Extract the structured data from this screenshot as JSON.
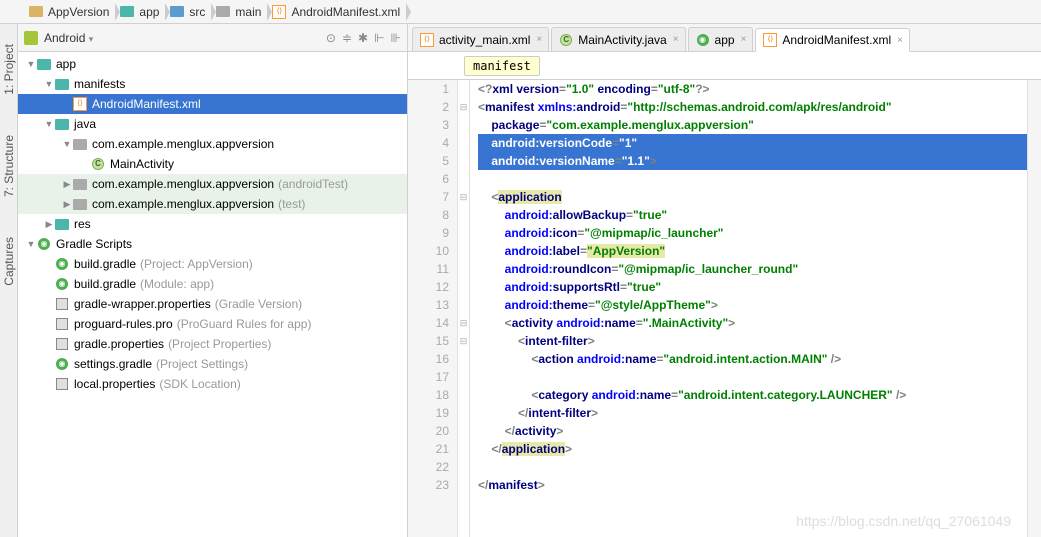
{
  "breadcrumb": [
    {
      "icon": "folder",
      "label": "AppVersion"
    },
    {
      "icon": "folder-teal",
      "label": "app"
    },
    {
      "icon": "folder-blue",
      "label": "src"
    },
    {
      "icon": "folder-gray",
      "label": "main"
    },
    {
      "icon": "xml",
      "label": "AndroidManifest.xml"
    }
  ],
  "leftTabs": [
    "1: Project",
    "7: Structure",
    "Captures"
  ],
  "sidebar": {
    "dropdown": "Android",
    "toolbarIcons": [
      "target",
      "collapse",
      "expand",
      "settings",
      "hide"
    ]
  },
  "tree": [
    {
      "depth": 0,
      "arrow": "▼",
      "icon": "folder-teal",
      "label": "app"
    },
    {
      "depth": 1,
      "arrow": "▼",
      "icon": "folder-teal",
      "label": "manifests"
    },
    {
      "depth": 2,
      "arrow": "",
      "icon": "xml",
      "label": "AndroidManifest.xml",
      "selected": true
    },
    {
      "depth": 1,
      "arrow": "▼",
      "icon": "folder-teal",
      "label": "java"
    },
    {
      "depth": 2,
      "arrow": "▼",
      "icon": "folder-gray",
      "label": "com.example.menglux.appversion"
    },
    {
      "depth": 3,
      "arrow": "",
      "icon": "class",
      "label": "MainActivity"
    },
    {
      "depth": 2,
      "arrow": "▶",
      "icon": "folder-gray",
      "label": "com.example.menglux.appversion",
      "hint": "(androidTest)",
      "hl": true
    },
    {
      "depth": 2,
      "arrow": "▶",
      "icon": "folder-gray",
      "label": "com.example.menglux.appversion",
      "hint": "(test)",
      "hl": true
    },
    {
      "depth": 1,
      "arrow": "▶",
      "icon": "folder-teal",
      "label": "res"
    },
    {
      "depth": 0,
      "arrow": "▼",
      "icon": "gradle",
      "label": "Gradle Scripts"
    },
    {
      "depth": 1,
      "arrow": "",
      "icon": "gradle",
      "label": "build.gradle",
      "hint": "(Project: AppVersion)"
    },
    {
      "depth": 1,
      "arrow": "",
      "icon": "gradle",
      "label": "build.gradle",
      "hint": "(Module: app)"
    },
    {
      "depth": 1,
      "arrow": "",
      "icon": "prop",
      "label": "gradle-wrapper.properties",
      "hint": "(Gradle Version)"
    },
    {
      "depth": 1,
      "arrow": "",
      "icon": "prop",
      "label": "proguard-rules.pro",
      "hint": "(ProGuard Rules for app)"
    },
    {
      "depth": 1,
      "arrow": "",
      "icon": "prop",
      "label": "gradle.properties",
      "hint": "(Project Properties)"
    },
    {
      "depth": 1,
      "arrow": "",
      "icon": "gradle",
      "label": "settings.gradle",
      "hint": "(Project Settings)"
    },
    {
      "depth": 1,
      "arrow": "",
      "icon": "prop",
      "label": "local.properties",
      "hint": "(SDK Location)"
    }
  ],
  "tabs": [
    {
      "icon": "xml",
      "label": "activity_main.xml",
      "active": false
    },
    {
      "icon": "class",
      "label": "MainActivity.java",
      "active": false
    },
    {
      "icon": "gradle",
      "label": "app",
      "active": false
    },
    {
      "icon": "xml",
      "label": "AndroidManifest.xml",
      "active": true
    }
  ],
  "crumb": "manifest",
  "code": {
    "lines": [
      {
        "n": 1,
        "fold": "",
        "html": "<span class='c'>&lt;?</span><span class='k'>xml version</span><span class='c'>=</span><span class='s'>\"1.0\"</span> <span class='k'>encoding</span><span class='c'>=</span><span class='s'>\"utf-8\"</span><span class='c'>?&gt;</span>"
      },
      {
        "n": 2,
        "fold": "⊟",
        "html": "<span class='c'>&lt;</span><span class='k'>manifest </span><span class='a'>xmlns:</span><span class='k'>android</span><span class='c'>=</span><span class='s'>\"http://schemas.android.com/apk/res/android\"</span>"
      },
      {
        "n": 3,
        "fold": "",
        "html": "    <span class='k'>package</span><span class='c'>=</span><span class='s'>\"com.example.menglux.appversion\"</span>"
      },
      {
        "n": 4,
        "fold": "",
        "sel": true,
        "html": "    <span class='a'>android:</span><span class='k'>versionCode</span><span class='c'>=</span><span class='s'>\"1\"</span>"
      },
      {
        "n": 5,
        "fold": "",
        "sel": true,
        "html": "    <span class='a'>android:</span><span class='k'>versionName</span><span class='c'>=</span><span class='s'>\"1.1\"</span><span class='c'>&gt;</span>"
      },
      {
        "n": 6,
        "fold": "",
        "html": ""
      },
      {
        "n": 7,
        "fold": "⊟",
        "html": "    <span class='c'>&lt;</span><span class='hl'><span class='k'>application</span></span>"
      },
      {
        "n": 8,
        "fold": "",
        "html": "        <span class='a'>android:</span><span class='k'>allowBackup</span><span class='c'>=</span><span class='s'>\"true\"</span>"
      },
      {
        "n": 9,
        "fold": "",
        "html": "        <span class='a'>android:</span><span class='k'>icon</span><span class='c'>=</span><span class='s'>\"@mipmap/ic_launcher\"</span>"
      },
      {
        "n": 10,
        "fold": "",
        "html": "        <span class='a'>android:</span><span class='k'>label</span><span class='c'>=</span><span class='hl'><span class='s'>\"AppVersion\"</span></span>"
      },
      {
        "n": 11,
        "fold": "",
        "html": "        <span class='a'>android:</span><span class='k'>roundIcon</span><span class='c'>=</span><span class='s'>\"@mipmap/ic_launcher_round\"</span>"
      },
      {
        "n": 12,
        "fold": "",
        "html": "        <span class='a'>android:</span><span class='k'>supportsRtl</span><span class='c'>=</span><span class='s'>\"true\"</span>"
      },
      {
        "n": 13,
        "fold": "",
        "html": "        <span class='a'>android:</span><span class='k'>theme</span><span class='c'>=</span><span class='s'>\"@style/AppTheme\"</span><span class='c'>&gt;</span>"
      },
      {
        "n": 14,
        "fold": "⊟",
        "html": "        <span class='c'>&lt;</span><span class='k'>activity </span><span class='a'>android:</span><span class='k'>name</span><span class='c'>=</span><span class='s'>\".MainActivity\"</span><span class='c'>&gt;</span>"
      },
      {
        "n": 15,
        "fold": "⊟",
        "html": "            <span class='c'>&lt;</span><span class='k'>intent-filter</span><span class='c'>&gt;</span>"
      },
      {
        "n": 16,
        "fold": "",
        "html": "                <span class='c'>&lt;</span><span class='k'>action </span><span class='a'>android:</span><span class='k'>name</span><span class='c'>=</span><span class='s'>\"android.intent.action.MAIN\"</span> <span class='c'>/&gt;</span>"
      },
      {
        "n": 17,
        "fold": "",
        "html": ""
      },
      {
        "n": 18,
        "fold": "",
        "html": "                <span class='c'>&lt;</span><span class='k'>category </span><span class='a'>android:</span><span class='k'>name</span><span class='c'>=</span><span class='s'>\"android.intent.category.LAUNCHER\"</span> <span class='c'>/&gt;</span>"
      },
      {
        "n": 19,
        "fold": "",
        "html": "            <span class='c'>&lt;/</span><span class='k'>intent-filter</span><span class='c'>&gt;</span>"
      },
      {
        "n": 20,
        "fold": "",
        "html": "        <span class='c'>&lt;/</span><span class='k'>activity</span><span class='c'>&gt;</span>"
      },
      {
        "n": 21,
        "fold": "",
        "html": "    <span class='c'>&lt;/</span><span class='hl'><span class='k'>application</span></span><span class='c'>&gt;</span>"
      },
      {
        "n": 22,
        "fold": "",
        "html": ""
      },
      {
        "n": 23,
        "fold": "",
        "html": "<span class='c'>&lt;/</span><span class='k'>manifest</span><span class='c'>&gt;</span>"
      }
    ]
  },
  "watermark": "https://blog.csdn.net/qq_27061049"
}
